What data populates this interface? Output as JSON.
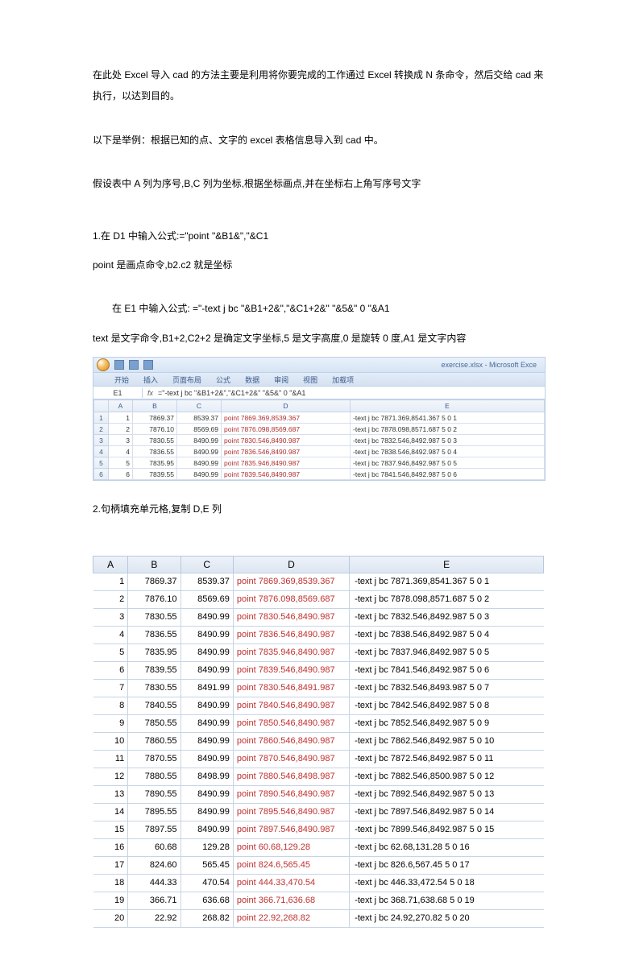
{
  "text": {
    "p1": "在此处 Excel 导入 cad 的方法主要是利用将你要完成的工作通过 Excel 转换成 N 条命令，然后交给 cad 来执行，以达到目的。",
    "p2": "以下是举例：根据已知的点、文字的 excel 表格信息导入到 cad 中。",
    "p3": "假设表中 A 列为序号,B,C 列为坐标,根据坐标画点,并在坐标右上角写序号文字",
    "p4": "1.在 D1 中输入公式:=\"point \"&B1&\",\"&C1",
    "p5": "point 是画点命令,b2.c2 就是坐标",
    "p6": "在 E1 中输入公式:  =\"-text j bc \"&B1+2&\",\"&C1+2&\" \"&5&\" 0 \"&A1",
    "p7": "text 是文字命令,B1+2,C2+2 是确定文字坐标,5 是文字高度,0 是旋转 0 度,A1 是文字内容",
    "p8": "2.句柄填充单元格,复制 D,E 列"
  },
  "shot1": {
    "title": "exercise.xlsx - Microsoft Exce",
    "tabs": [
      "开始",
      "插入",
      "页面布局",
      "公式",
      "数据",
      "审阅",
      "视图",
      "加载项"
    ],
    "name_box": "E1",
    "formula": "=\"-text j bc \"&B1+2&\",\"&C1+2&\" \"&5&\" 0 \"&A1",
    "headers": [
      "",
      "A",
      "B",
      "C",
      "D",
      "E"
    ],
    "rows": [
      {
        "n": "1",
        "a": "1",
        "b": "7869.37",
        "c": "8539.37",
        "d": "point 7869.369,8539.367",
        "e": "-text j bc 7871.369,8541.367 5 0 1"
      },
      {
        "n": "2",
        "a": "2",
        "b": "7876.10",
        "c": "8569.69",
        "d": "point 7876.098,8569.687",
        "e": "-text j bc 7878.098,8571.687 5 0 2"
      },
      {
        "n": "3",
        "a": "3",
        "b": "7830.55",
        "c": "8490.99",
        "d": "point 7830.546,8490.987",
        "e": "-text j bc 7832.546,8492.987 5 0 3"
      },
      {
        "n": "4",
        "a": "4",
        "b": "7836.55",
        "c": "8490.99",
        "d": "point 7836.546,8490.987",
        "e": "-text j bc 7838.546,8492.987 5 0 4"
      },
      {
        "n": "5",
        "a": "5",
        "b": "7835.95",
        "c": "8490.99",
        "d": "point 7835.946,8490.987",
        "e": "-text j bc 7837.946,8492.987 5 0 5"
      },
      {
        "n": "6",
        "a": "6",
        "b": "7839.55",
        "c": "8490.99",
        "d": "point 7839.546,8490.987",
        "e": "-text j bc 7841.546,8492.987 5 0 6"
      }
    ]
  },
  "chart_data": {
    "type": "table",
    "headers": [
      "A",
      "B",
      "C",
      "D",
      "E"
    ],
    "rows": [
      {
        "a": "1",
        "b": "7869.37",
        "c": "8539.37",
        "d": "point 7869.369,8539.367",
        "e": "-text j bc 7871.369,8541.367 5 0 1"
      },
      {
        "a": "2",
        "b": "7876.10",
        "c": "8569.69",
        "d": "point 7876.098,8569.687",
        "e": "-text j bc 7878.098,8571.687 5 0 2"
      },
      {
        "a": "3",
        "b": "7830.55",
        "c": "8490.99",
        "d": "point 7830.546,8490.987",
        "e": "-text j bc 7832.546,8492.987 5 0 3"
      },
      {
        "a": "4",
        "b": "7836.55",
        "c": "8490.99",
        "d": "point 7836.546,8490.987",
        "e": "-text j bc 7838.546,8492.987 5 0 4"
      },
      {
        "a": "5",
        "b": "7835.95",
        "c": "8490.99",
        "d": "point 7835.946,8490.987",
        "e": "-text j bc 7837.946,8492.987 5 0 5"
      },
      {
        "a": "6",
        "b": "7839.55",
        "c": "8490.99",
        "d": "point 7839.546,8490.987",
        "e": "-text j bc 7841.546,8492.987 5 0 6"
      },
      {
        "a": "7",
        "b": "7830.55",
        "c": "8491.99",
        "d": "point 7830.546,8491.987",
        "e": "-text j bc 7832.546,8493.987 5 0 7"
      },
      {
        "a": "8",
        "b": "7840.55",
        "c": "8490.99",
        "d": "point 7840.546,8490.987",
        "e": "-text j bc 7842.546,8492.987 5 0 8"
      },
      {
        "a": "9",
        "b": "7850.55",
        "c": "8490.99",
        "d": "point 7850.546,8490.987",
        "e": "-text j bc 7852.546,8492.987 5 0 9"
      },
      {
        "a": "10",
        "b": "7860.55",
        "c": "8490.99",
        "d": "point 7860.546,8490.987",
        "e": "-text j bc 7862.546,8492.987 5 0 10"
      },
      {
        "a": "11",
        "b": "7870.55",
        "c": "8490.99",
        "d": "point 7870.546,8490.987",
        "e": "-text j bc 7872.546,8492.987 5 0 11"
      },
      {
        "a": "12",
        "b": "7880.55",
        "c": "8498.99",
        "d": "point 7880.546,8498.987",
        "e": "-text j bc 7882.546,8500.987 5 0 12"
      },
      {
        "a": "13",
        "b": "7890.55",
        "c": "8490.99",
        "d": "point 7890.546,8490.987",
        "e": "-text j bc 7892.546,8492.987 5 0 13"
      },
      {
        "a": "14",
        "b": "7895.55",
        "c": "8490.99",
        "d": "point 7895.546,8490.987",
        "e": "-text j bc 7897.546,8492.987 5 0 14"
      },
      {
        "a": "15",
        "b": "7897.55",
        "c": "8490.99",
        "d": "point 7897.546,8490.987",
        "e": "-text j bc 7899.546,8492.987 5 0 15"
      },
      {
        "a": "16",
        "b": "60.68",
        "c": "129.28",
        "d": "point 60.68,129.28",
        "e": "-text j bc 62.68,131.28 5 0 16"
      },
      {
        "a": "17",
        "b": "824.60",
        "c": "565.45",
        "d": "point 824.6,565.45",
        "e": "-text j bc 826.6,567.45 5 0 17"
      },
      {
        "a": "18",
        "b": "444.33",
        "c": "470.54",
        "d": "point 444.33,470.54",
        "e": "-text j bc 446.33,472.54 5 0 18"
      },
      {
        "a": "19",
        "b": "366.71",
        "c": "636.68",
        "d": "point 366.71,636.68",
        "e": "-text j bc 368.71,638.68 5 0 19"
      },
      {
        "a": "20",
        "b": "22.92",
        "c": "268.82",
        "d": "point 22.92,268.82",
        "e": "-text j bc 24.92,270.82 5 0 20"
      }
    ]
  }
}
